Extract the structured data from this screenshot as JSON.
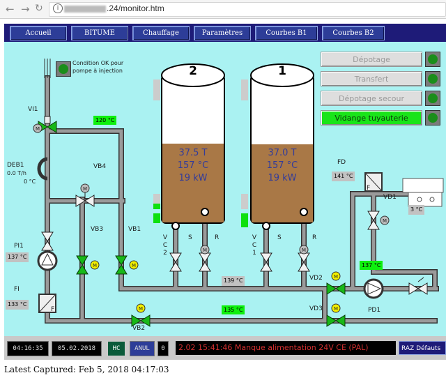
{
  "browser": {
    "url_host_suffix": ".24",
    "url_path": "/monitor.htm"
  },
  "nav_tabs": [
    "Accueil",
    "BITUME",
    "Chauffage",
    "Paramètres",
    "Courbes B1",
    "Courbes B2"
  ],
  "labels": {
    "condition_line1": "Condition OK pour",
    "condition_line2": "pompe à injection",
    "vi1": "VI1",
    "vb4": "VB4",
    "vb3": "VB3",
    "vb1": "VB1",
    "vb2": "VB2",
    "deb1": "DEB1",
    "deb1_flow": "0.0 T/h",
    "deb1_temp": "0 °C",
    "pi1": "PI1",
    "fi": "FI",
    "fd": "FD",
    "vd1": "VD1",
    "vd2": "VD2",
    "vd3": "VD3",
    "pd1": "PD1",
    "vc2": [
      "V",
      "C",
      "2"
    ],
    "vc1": [
      "V",
      "C",
      "1"
    ],
    "s": "S",
    "r": "R",
    "m": "M",
    "f": "F"
  },
  "temps": {
    "pipe_top": "120 °C",
    "pi1": "137 °C",
    "fi": "133 °C",
    "fd": "141 °C",
    "vd1": "3 °C",
    "pipe_bottom": "135 °C",
    "pipe_right": "137 °C",
    "return_left": "139 °C"
  },
  "tanks": [
    {
      "number": "2",
      "tonnage": "37.5 T",
      "temp": "157 °C",
      "power": "19 kW",
      "level_pct": 44
    },
    {
      "number": "1",
      "tonnage": "37.0 T",
      "temp": "157 °C",
      "power": "19 kW",
      "level_pct": 43
    }
  ],
  "commands": [
    {
      "label": "Dépotage",
      "active": false
    },
    {
      "label": "Transfert",
      "active": false
    },
    {
      "label": "Dépotage secour",
      "active": false
    },
    {
      "label": "Vidange tuyauterie",
      "active": true
    }
  ],
  "status": {
    "time": "04:16:35",
    "date": "05.02.2018",
    "hc": "HC",
    "anul": "ANUL",
    "counter": "0",
    "alarm": "2.02 15:41:46 Manque alimentation 24V CE (PAL)",
    "raz": "RAZ Défauts"
  },
  "caption": "Latest Captured: Feb 5, 2018 04:17:03",
  "colors": {
    "background": "#aaf2f2",
    "pipe": "#9a9a9a",
    "bitumen": "#a97846",
    "valve_open": "#18b818",
    "status_green": "#0ef00e",
    "nav_bar": "#1e1b78"
  }
}
